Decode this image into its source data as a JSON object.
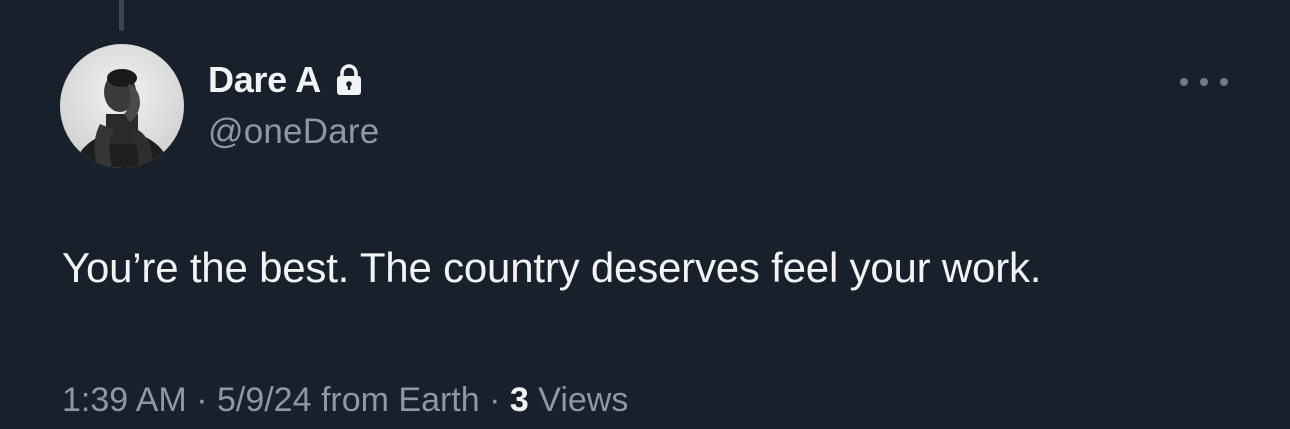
{
  "tweet": {
    "author": {
      "display_name": "Dare A",
      "handle": "@oneDare",
      "verified_icon": "lock-icon"
    },
    "text": "You’re the best. The country deserves feel your work.",
    "meta": {
      "time": "1:39 AM",
      "sep1": " · ",
      "date": "5/9/24",
      "source": " from Earth",
      "sep2": " · ",
      "views_count": "3",
      "views_label": " Views"
    },
    "more_icon": "more-options-icon"
  },
  "colors": {
    "background": "#18202b",
    "primary_text": "#f2f3f4",
    "secondary_text": "#8b98a5"
  }
}
